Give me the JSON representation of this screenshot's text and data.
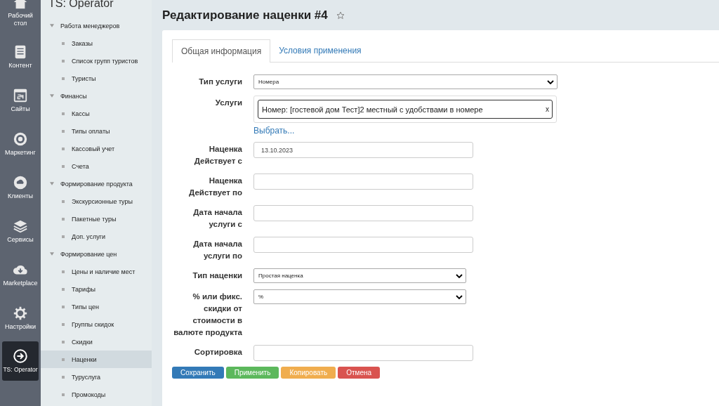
{
  "rail": [
    {
      "label": "Рабочий стол",
      "selected": false
    },
    {
      "label": "Контент",
      "selected": false
    },
    {
      "label": "Сайты",
      "selected": false
    },
    {
      "label": "Маркетинг",
      "selected": false
    },
    {
      "label": "Клиенты",
      "selected": false
    },
    {
      "label": "Сервисы",
      "selected": false
    },
    {
      "label": "Marketplace",
      "selected": false
    },
    {
      "label": "Настройки",
      "selected": false
    },
    {
      "label": "TS: Operator",
      "selected": true
    }
  ],
  "sidebar": {
    "title": "TS: Operator",
    "groups": [
      {
        "label": "Работа менеджеров",
        "expanded": true,
        "children": [
          {
            "label": "Заказы",
            "selected": false
          },
          {
            "label": "Список групп туристов",
            "selected": false
          },
          {
            "label": "Туристы",
            "selected": false
          }
        ]
      },
      {
        "label": "Финансы",
        "expanded": true,
        "children": [
          {
            "label": "Кассы",
            "selected": false
          },
          {
            "label": "Типы оплаты",
            "selected": false
          },
          {
            "label": "Кассовый учет",
            "selected": false
          },
          {
            "label": "Счета",
            "selected": false
          }
        ]
      },
      {
        "label": "Формирование продукта",
        "expanded": true,
        "children": [
          {
            "label": "Экскурсионные туры",
            "selected": false
          },
          {
            "label": "Пакетные туры",
            "selected": false
          },
          {
            "label": "Доп. услуги",
            "selected": false
          }
        ]
      },
      {
        "label": "Формирование цен",
        "expanded": true,
        "children": [
          {
            "label": "Цены и наличие мест",
            "selected": false
          },
          {
            "label": "Тарифы",
            "selected": false
          },
          {
            "label": "Типы цен",
            "selected": false
          },
          {
            "label": "Группы скидок",
            "selected": false
          },
          {
            "label": "Скидки",
            "selected": false
          },
          {
            "label": "Наценки",
            "selected": true
          },
          {
            "label": "Туруслуга",
            "selected": false
          },
          {
            "label": "Промокоды",
            "selected": false
          }
        ]
      }
    ]
  },
  "page": {
    "title": "Редактирование наценки #4",
    "favorite": false
  },
  "tabs": [
    {
      "label": "Общая информация",
      "selected": true
    },
    {
      "label": "Условия применения",
      "selected": false
    }
  ],
  "fields": [
    {
      "kind": "select",
      "label": "Тип услуги",
      "value": "Номера",
      "wide": true
    },
    {
      "kind": "multi",
      "label": "Услуги",
      "tag": "Номер: [гостевой дом Тест]2 местный с удобствами в номере",
      "remove": "x",
      "link": "Выбрать..."
    },
    {
      "kind": "text",
      "label": "Наценка Действует с",
      "value": "13.10.2023"
    },
    {
      "kind": "text",
      "label": "Наценка Действует по"
    },
    {
      "kind": "text",
      "label": "Дата начала услуги с"
    },
    {
      "kind": "text",
      "label": "Дата начала услуги по"
    },
    {
      "kind": "select",
      "label": "Тип наценки",
      "value": "Простая наценка",
      "wide": false
    },
    {
      "kind": "select",
      "label": "% или фикс. скидки от стоимости в валюте продукта",
      "value": "%",
      "wide": false
    },
    {
      "kind": "text",
      "label": "Сортировка"
    }
  ],
  "buttons": [
    {
      "label": "Сохранить",
      "color": "#337ab7"
    },
    {
      "label": "Применить",
      "color": "#5cb85c"
    },
    {
      "label": "Копировать",
      "color": "#f0ad4e"
    },
    {
      "label": "Отмена",
      "color": "#d9534f"
    }
  ]
}
